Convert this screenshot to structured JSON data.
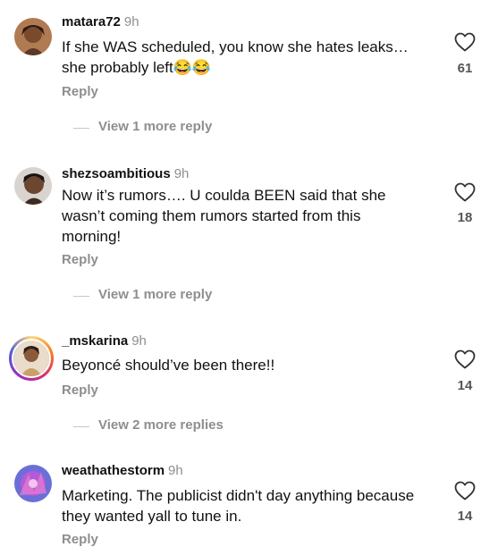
{
  "comments": [
    {
      "username": "matara72",
      "time": "9h",
      "text": "If she WAS scheduled, you know she hates leaks…she probably left😂😂",
      "reply_label": "Reply",
      "likes": "61",
      "view_replies": "View 1 more reply"
    },
    {
      "username": "shezsoambitious",
      "time": "9h",
      "text": "Now it’s rumors…. U coulda BEEN said that she wasn’t coming them rumors started from this morning!",
      "reply_label": "Reply",
      "likes": "18",
      "view_replies": "View 1 more reply"
    },
    {
      "username": "_mskarina",
      "time": "9h",
      "text": "Beyoncé should’ve been there!!",
      "reply_label": "Reply",
      "likes": "14",
      "view_replies": "View 2 more replies"
    },
    {
      "username": "weathathestorm",
      "time": "9h",
      "text": "Marketing. The publicist didn't day anything because they wanted yall to tune in.",
      "reply_label": "Reply",
      "likes": "14"
    }
  ],
  "icons": {
    "like": "heart-outline-icon",
    "menu": "more-dots-icon"
  }
}
